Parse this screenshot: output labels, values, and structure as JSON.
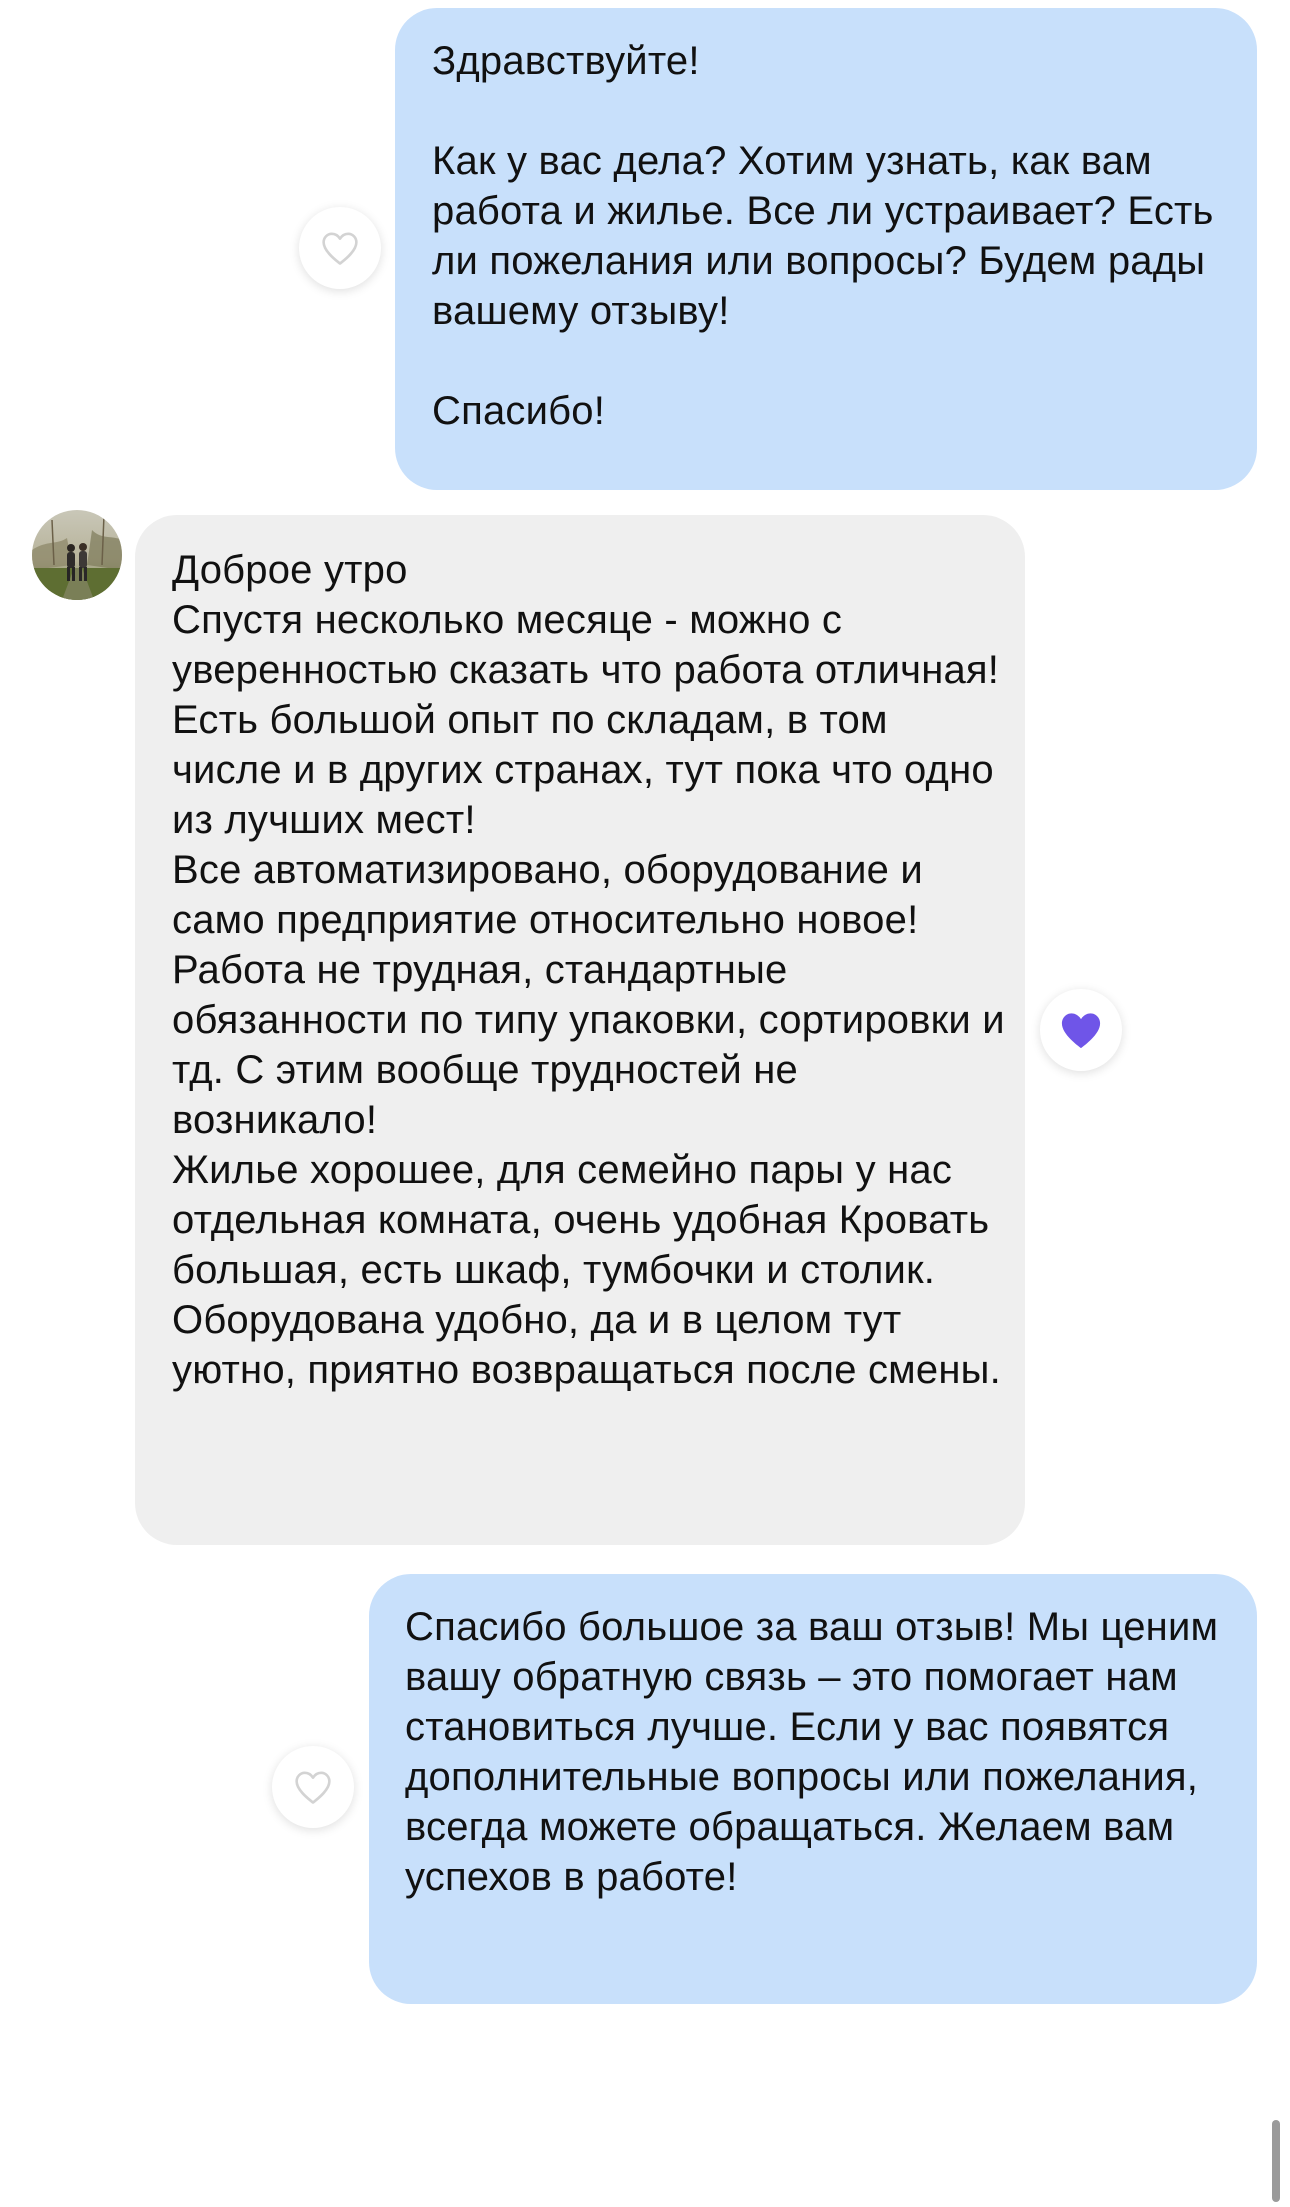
{
  "messages": [
    {
      "direction": "outgoing",
      "text": "Здравствуйте!\n\nКак у вас дела? Хотим узнать, как вам работа и жилье. Все ли устраивает? Есть ли пожелания или вопросы? Будем рады вашему отзыву!\n\nСпасибо!",
      "reaction": {
        "icon": "heart-outline-icon",
        "liked": false
      }
    },
    {
      "direction": "incoming",
      "text": "Доброе утро\nСпустя несколько месяце - можно с уверенностью сказать что работа отличная! Есть большой опыт по складам, в том числе и в других странах, тут пока что одно из лучших мест!\nВсе автоматизировано, оборудование и само предприятие относительно новое!\nРабота не трудная, стандартные обязанности по типу упаковки, сортировки и тд. С этим вообще трудностей не возникало!\nЖилье хорошее, для семейно пары у нас отдельная комната, очень удобная Кровать большая, есть шкаф, тумбочки и столик. Оборудована удобно, да и в целом тут уютно, приятно возвращаться после смены.",
      "avatar": "user-avatar",
      "reaction": {
        "icon": "heart-filled-icon",
        "liked": true
      }
    },
    {
      "direction": "outgoing",
      "text": "Спасибо большое за ваш отзыв! Мы ценим вашу обратную связь – это помогает нам становиться лучше. Если у вас появятся дополнительные вопросы или пожелания, всегда можете обращаться. Желаем вам успехов в работе!",
      "reaction": {
        "icon": "heart-outline-icon",
        "liked": false
      }
    }
  ],
  "colors": {
    "outgoing_bubble": "#c8e0fb",
    "incoming_bubble": "#efefef",
    "heart_filled": "#6f55e8",
    "heart_outline": "#d3d3d3"
  }
}
